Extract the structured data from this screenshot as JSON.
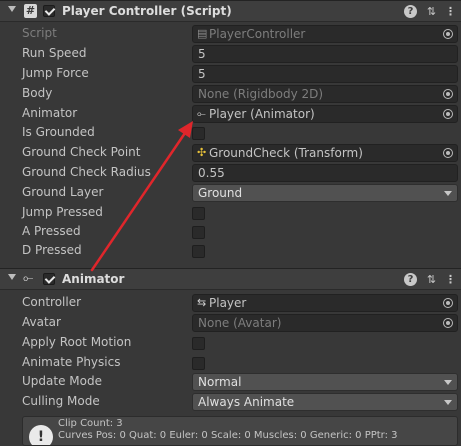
{
  "player_controller": {
    "title": "Player Controller (Script)",
    "fields": {
      "script": {
        "label": "Script",
        "value": "PlayerController"
      },
      "run_speed": {
        "label": "Run Speed",
        "value": "5"
      },
      "jump_force": {
        "label": "Jump Force",
        "value": "5"
      },
      "body": {
        "label": "Body",
        "value": "None (Rigidbody 2D)"
      },
      "animator": {
        "label": "Animator",
        "value": "Player (Animator)"
      },
      "is_grounded": {
        "label": "Is Grounded"
      },
      "ground_check_point": {
        "label": "Ground Check Point",
        "value": "GroundCheck (Transform)"
      },
      "ground_check_radius": {
        "label": "Ground Check Radius",
        "value": "0.55"
      },
      "ground_layer": {
        "label": "Ground Layer",
        "value": "Ground"
      },
      "jump_pressed": {
        "label": "Jump Pressed"
      },
      "a_pressed": {
        "label": "A Pressed"
      },
      "d_pressed": {
        "label": "D Pressed"
      }
    }
  },
  "animator_component": {
    "title": "Animator",
    "fields": {
      "controller": {
        "label": "Controller",
        "value": "Player"
      },
      "avatar": {
        "label": "Avatar",
        "value": "None (Avatar)"
      },
      "apply_root_motion": {
        "label": "Apply Root Motion"
      },
      "animate_physics": {
        "label": "Animate Physics"
      },
      "update_mode": {
        "label": "Update Mode",
        "value": "Normal"
      },
      "culling_mode": {
        "label": "Culling Mode",
        "value": "Always Animate"
      }
    },
    "info": {
      "line1": "Clip Count: 3",
      "line2": "Curves Pos: 0 Quat: 0 Euler: 0 Scale: 0 Muscles: 0 Generic: 0 PPtr: 3"
    }
  },
  "colors": {
    "arrow": "#e0262b",
    "background": "#383838",
    "header": "#3e3e3e"
  },
  "icons": {
    "script_header": "hash-script-icon",
    "animator_header": "animator-icon",
    "help": "help-icon",
    "presets": "presets-icon",
    "menu": "kebab-menu-icon"
  }
}
